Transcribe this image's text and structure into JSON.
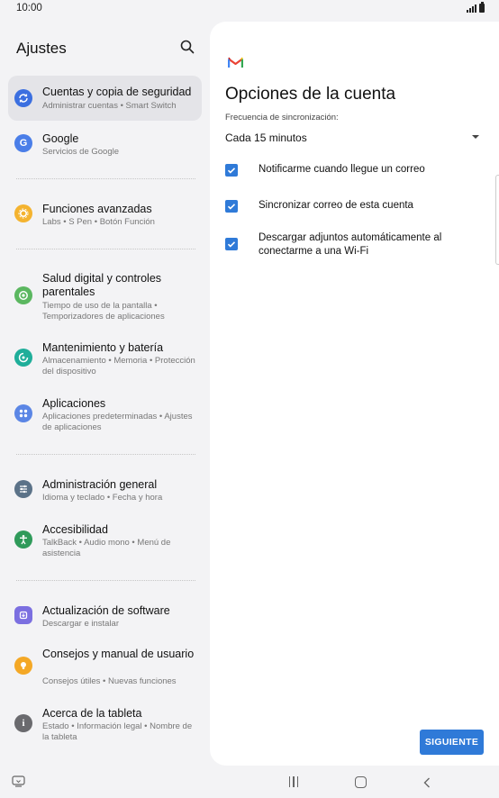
{
  "status_bar": {
    "time": "10:00"
  },
  "sidebar": {
    "title": "Ajustes",
    "items": [
      {
        "id": "cuentas",
        "title": "Cuentas y copia de seguridad",
        "subtitle": "Administrar cuentas  •  Smart Switch",
        "icon": "sync-icon",
        "color": "#3b6fe0",
        "selected": true
      },
      {
        "id": "google",
        "title": "Google",
        "subtitle": "Servicios de Google",
        "icon": "google-icon",
        "color": "#4a7ee8"
      },
      {
        "id": "funciones",
        "title": "Funciones avanzadas",
        "subtitle": "Labs  •  S Pen  •  Botón Función",
        "icon": "gear-icon",
        "color": "#f4b32f"
      },
      {
        "id": "salud",
        "title": "Salud digital y controles parentales",
        "subtitle": "Tiempo de uso de la pantalla  •  Temporizadores de aplicaciones",
        "icon": "digital-wellbeing-icon",
        "color": "#5bb760"
      },
      {
        "id": "mantenimiento",
        "title": "Mantenimiento y batería",
        "subtitle": "Almacenamiento  •  Memoria  •  Protección del dispositivo",
        "icon": "device-care-icon",
        "color": "#1fae9a"
      },
      {
        "id": "aplicaciones",
        "title": "Aplicaciones",
        "subtitle": "Aplicaciones predeterminadas  •  Ajustes de aplicaciones",
        "icon": "apps-icon",
        "color": "#5b86e5"
      },
      {
        "id": "administracion",
        "title": "Administración general",
        "subtitle": "Idioma y teclado  •  Fecha y hora",
        "icon": "sliders-icon",
        "color": "#5b7288"
      },
      {
        "id": "accesibilidad",
        "title": "Accesibilidad",
        "subtitle": "TalkBack  •  Audio mono  •  Menú de asistencia",
        "icon": "accessibility-icon",
        "color": "#2f9a5a"
      },
      {
        "id": "actualizacion",
        "title": "Actualización de software",
        "subtitle": "Descargar e instalar",
        "icon": "software-update-icon",
        "color": "#7b6fe0"
      },
      {
        "id": "consejos",
        "title": "Consejos y manual de usuario",
        "subtitle": "Consejos útiles  •  Nuevas funciones",
        "icon": "lightbulb-icon",
        "color": "#f4a826"
      },
      {
        "id": "acerca",
        "title": "Acerca de la tableta",
        "subtitle": "Estado  •  Información legal  •  Nombre de la tableta",
        "icon": "info-icon",
        "color": "#6a6a6e"
      }
    ]
  },
  "panel": {
    "logo": "gmail-logo",
    "title": "Opciones de la cuenta",
    "frequency_label": "Frecuencia de sincronización:",
    "frequency_value": "Cada 15 minutos",
    "options": [
      {
        "label": "Notificarme cuando llegue un correo",
        "checked": true
      },
      {
        "label": "Sincronizar correo de esta cuenta",
        "checked": true
      },
      {
        "label": "Descargar adjuntos automáticamente al conectarme a una Wi-Fi",
        "checked": true
      }
    ],
    "next_label": "SIGUIENTE",
    "accent_color": "#2f7ad8"
  }
}
